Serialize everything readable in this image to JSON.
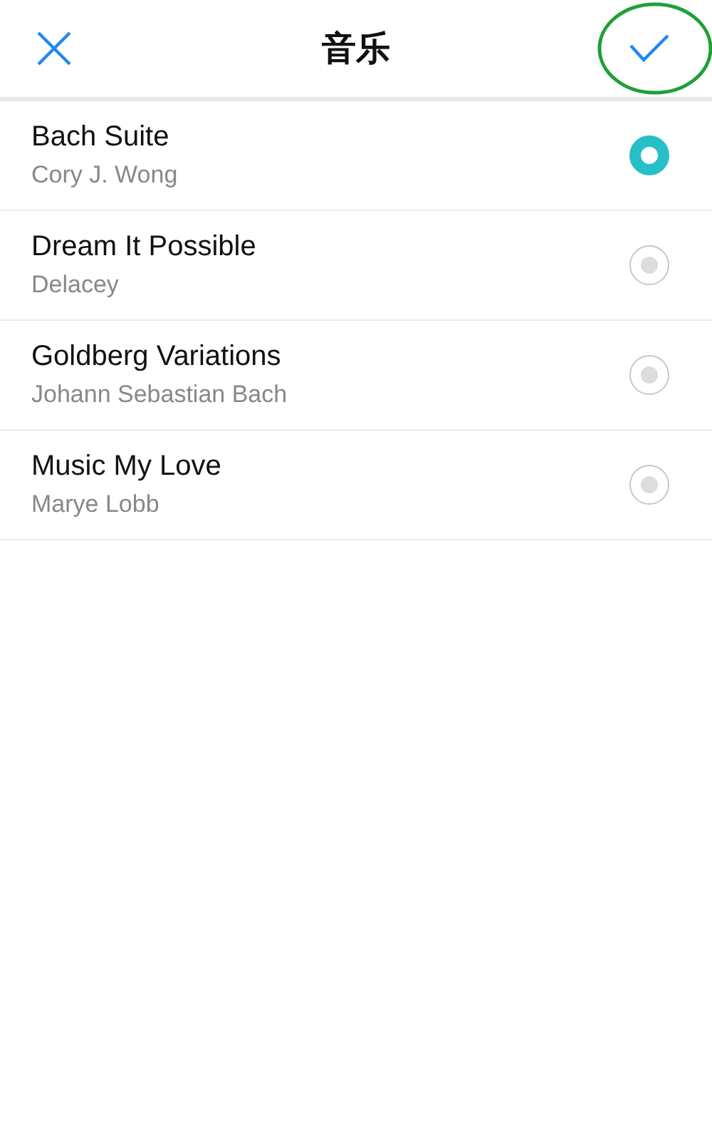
{
  "header": {
    "title": "音乐",
    "confirm_highlighted": true
  },
  "songs": [
    {
      "title": "Bach Suite",
      "artist": "Cory J. Wong",
      "selected": true
    },
    {
      "title": "Dream It Possible",
      "artist": "Delacey",
      "selected": false
    },
    {
      "title": "Goldberg Variations",
      "artist": "Johann Sebastian Bach",
      "selected": false
    },
    {
      "title": "Music My Love",
      "artist": "Marye Lobb",
      "selected": false
    }
  ]
}
